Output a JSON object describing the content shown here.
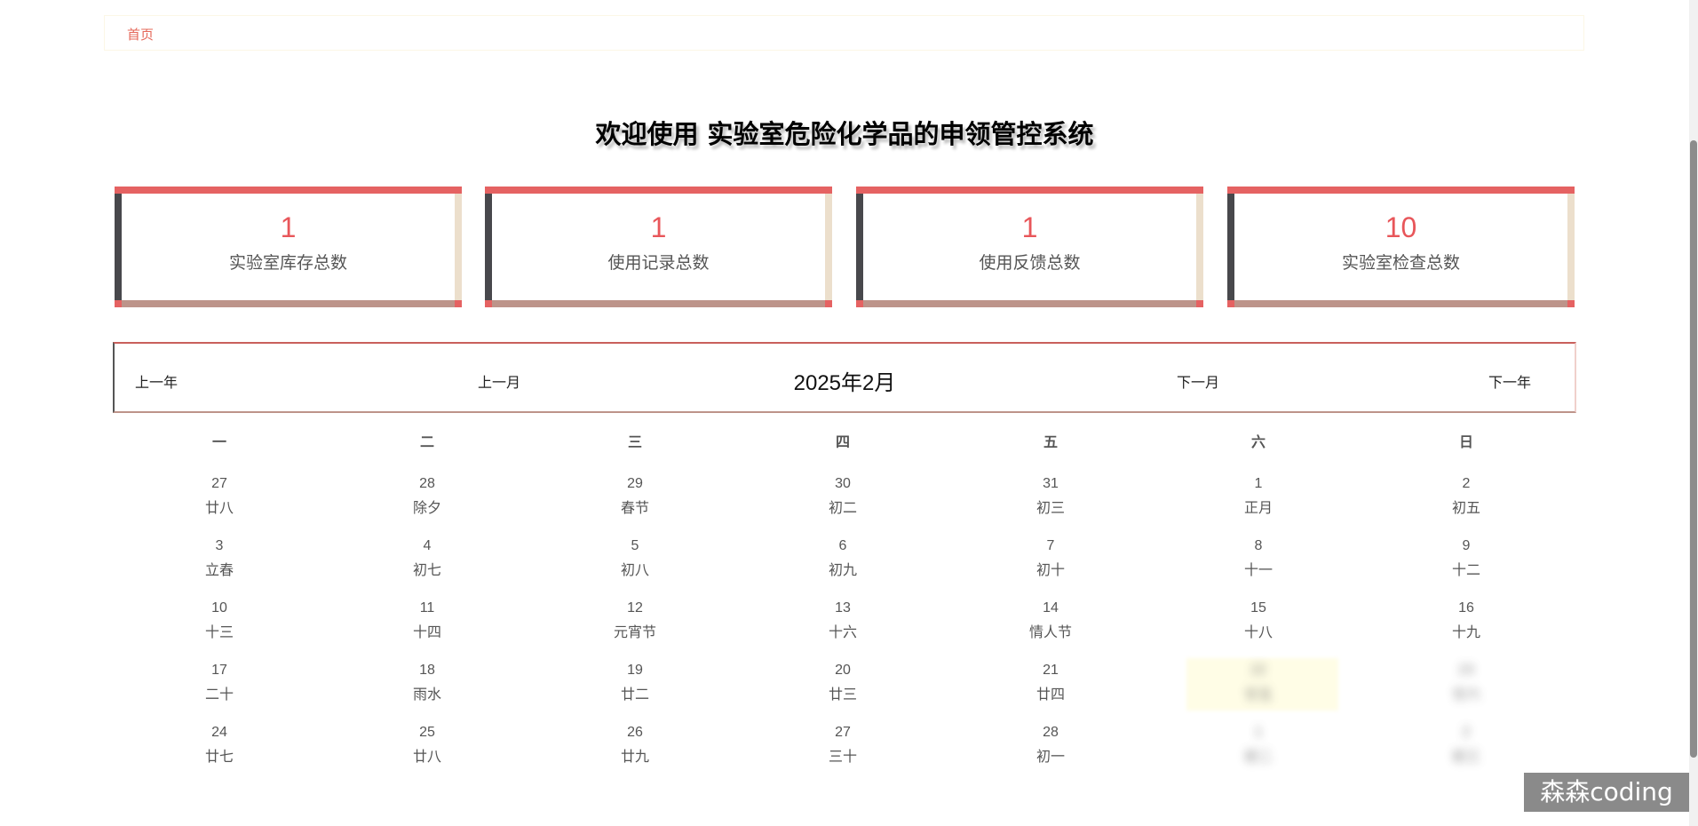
{
  "breadcrumb": {
    "home": "首页"
  },
  "title": "欢迎使用 实验室危险化学品的申领管控系统",
  "cards": [
    {
      "value": "1",
      "label": "实验室库存总数"
    },
    {
      "value": "1",
      "label": "使用记录总数"
    },
    {
      "value": "1",
      "label": "使用反馈总数"
    },
    {
      "value": "10",
      "label": "实验室检查总数"
    }
  ],
  "calendar": {
    "prev_year": "上一年",
    "prev_month": "上一月",
    "title": "2025年2月",
    "next_month": "下一月",
    "next_year": "下一年",
    "weekdays": [
      "一",
      "二",
      "三",
      "四",
      "五",
      "六",
      "日"
    ],
    "weeks": [
      [
        [
          "27",
          "廿八"
        ],
        [
          "28",
          "除夕"
        ],
        [
          "29",
          "春节"
        ],
        [
          "30",
          "初二"
        ],
        [
          "31",
          "初三"
        ],
        [
          "1",
          "正月"
        ],
        [
          "2",
          "初五"
        ]
      ],
      [
        [
          "3",
          "立春"
        ],
        [
          "4",
          "初七"
        ],
        [
          "5",
          "初八"
        ],
        [
          "6",
          "初九"
        ],
        [
          "7",
          "初十"
        ],
        [
          "8",
          "十一"
        ],
        [
          "9",
          "十二"
        ]
      ],
      [
        [
          "10",
          "十三"
        ],
        [
          "11",
          "十四"
        ],
        [
          "12",
          "元宵节"
        ],
        [
          "13",
          "十六"
        ],
        [
          "14",
          "情人节"
        ],
        [
          "15",
          "十八"
        ],
        [
          "16",
          "十九"
        ]
      ],
      [
        [
          "17",
          "二十"
        ],
        [
          "18",
          "雨水"
        ],
        [
          "19",
          "廿二"
        ],
        [
          "20",
          "廿三"
        ],
        [
          "21",
          "廿四"
        ],
        [
          "22",
          "廿五"
        ],
        [
          "23",
          "廿六"
        ]
      ],
      [
        [
          "24",
          "廿七"
        ],
        [
          "25",
          "廿八"
        ],
        [
          "26",
          "廿九"
        ],
        [
          "27",
          "三十"
        ],
        [
          "28",
          "初一"
        ],
        [
          "1",
          "初二"
        ],
        [
          "2",
          "初三"
        ]
      ]
    ]
  },
  "watermark": "森森coding"
}
